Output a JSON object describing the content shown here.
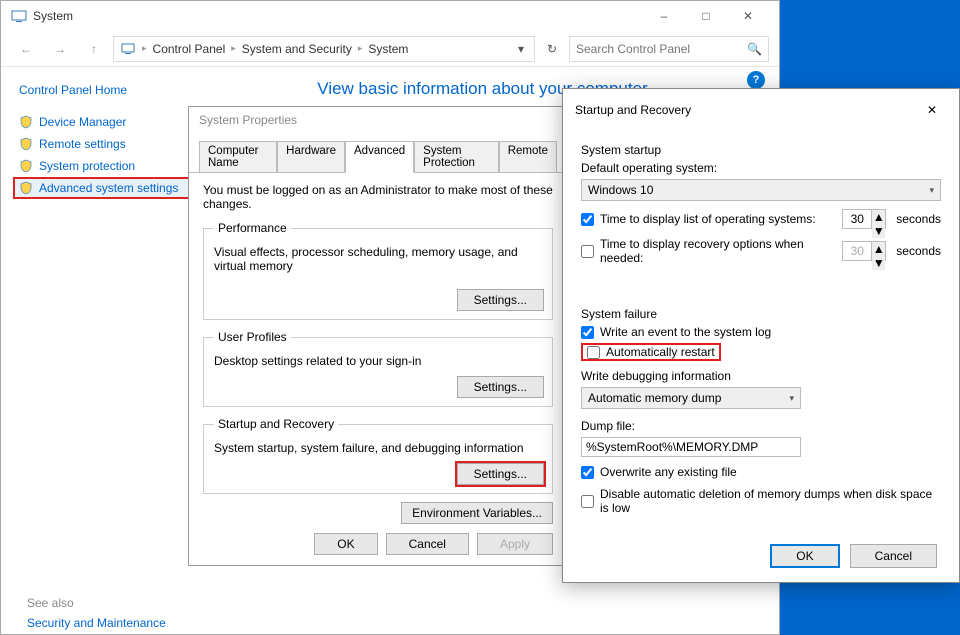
{
  "window": {
    "title": "System",
    "min_tip": "Minimize",
    "max_tip": "Maximize",
    "close_tip": "Close"
  },
  "nav": {
    "back": "Back",
    "fwd": "Forward",
    "up": "Up",
    "breadcrumb": [
      "Control Panel",
      "System and Security",
      "System"
    ],
    "refresh": "Refresh",
    "search_placeholder": "Search Control Panel"
  },
  "sidebar": {
    "home": "Control Panel Home",
    "items": [
      {
        "label": "Device Manager"
      },
      {
        "label": "Remote settings"
      },
      {
        "label": "System protection"
      },
      {
        "label": "Advanced system settings"
      }
    ],
    "see_also": "See also",
    "sec_maint": "Security and Maintenance"
  },
  "content": {
    "heading": "View basic information about your computer",
    "help": "?"
  },
  "sysprop": {
    "title": "System Properties",
    "tabs": [
      "Computer Name",
      "Hardware",
      "Advanced",
      "System Protection",
      "Remote"
    ],
    "note": "You must be logged on as an Administrator to make most of these changes.",
    "perf": {
      "legend": "Performance",
      "desc": "Visual effects, processor scheduling, memory usage, and virtual memory",
      "btn": "Settings..."
    },
    "up": {
      "legend": "User Profiles",
      "desc": "Desktop settings related to your sign-in",
      "btn": "Settings..."
    },
    "sr": {
      "legend": "Startup and Recovery",
      "desc": "System startup, system failure, and debugging information",
      "btn": "Settings..."
    },
    "env_btn": "Environment Variables...",
    "ok": "OK",
    "cancel": "Cancel",
    "apply": "Apply"
  },
  "srdialog": {
    "title": "Startup and Recovery",
    "startup": {
      "section": "System startup",
      "default_os_lbl": "Default operating system:",
      "default_os_val": "Windows 10",
      "time_list_chk": true,
      "time_list_lbl": "Time to display list of operating systems:",
      "time_list_val": "30",
      "time_list_unit": "seconds",
      "time_rec_chk": false,
      "time_rec_lbl": "Time to display recovery options when needed:",
      "time_rec_val": "30",
      "time_rec_unit": "seconds"
    },
    "failure": {
      "section": "System failure",
      "write_evt_chk": true,
      "write_evt_lbl": "Write an event to the system log",
      "auto_restart_chk": false,
      "auto_restart_lbl": "Automatically restart",
      "write_dbg_lbl": "Write debugging information",
      "dump_type": "Automatic memory dump",
      "dump_file_lbl": "Dump file:",
      "dump_file_val": "%SystemRoot%\\MEMORY.DMP",
      "overwrite_chk": true,
      "overwrite_lbl": "Overwrite any existing file",
      "disable_del_chk": false,
      "disable_del_lbl": "Disable automatic deletion of memory dumps when disk space is low"
    },
    "ok": "OK",
    "cancel": "Cancel"
  }
}
